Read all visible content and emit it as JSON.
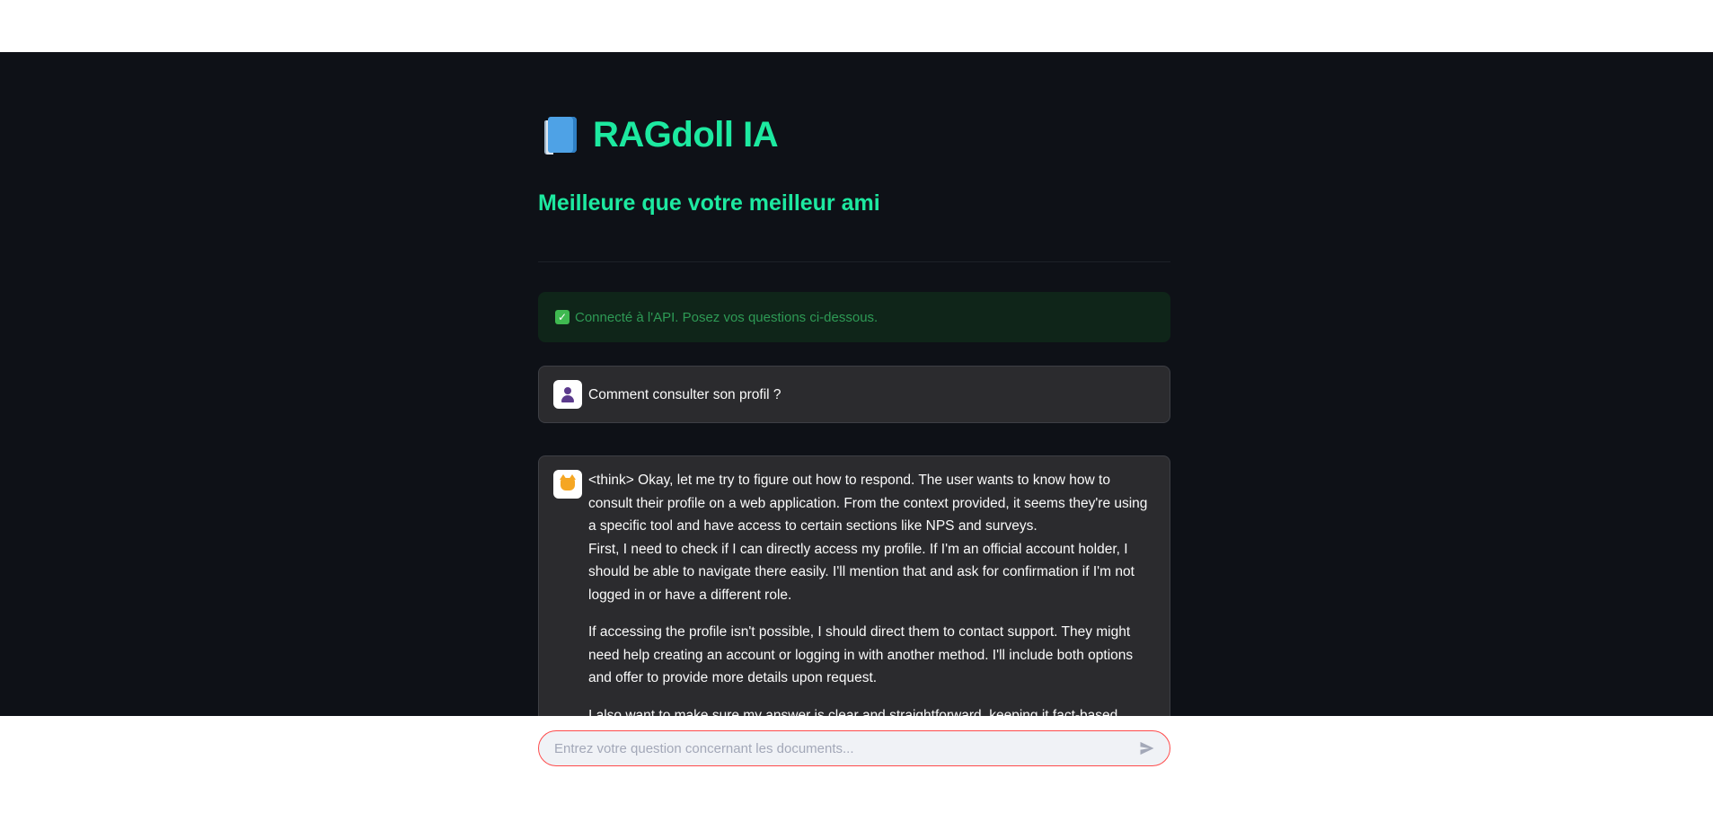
{
  "header": {
    "title": "RAGdoll IA",
    "title_icon": "book-icon",
    "subtitle": "Meilleure que votre meilleur ami"
  },
  "status": {
    "icon": "check-icon",
    "text": "Connecté à l'API. Posez vos questions ci-dessous."
  },
  "messages": [
    {
      "role": "user",
      "avatar": "user-icon",
      "text": "Comment consulter son profil ?"
    },
    {
      "role": "assistant",
      "avatar": "cat-icon",
      "paragraphs": [
        "<think> Okay, let me try to figure out how to respond. The user wants to know how to consult their profile on a web application. From the context provided, it seems they're using a specific tool and have access to certain sections like NPS and surveys.",
        "First, I need to check if I can directly access my profile. If I'm an official account holder, I should be able to navigate there easily. I'll mention that and ask for confirmation if I'm not logged in or have a different role.",
        "If accessing the profile isn't possible, I should direct them to contact support. They might need help creating an account or logging in with another method. I'll include both options and offer to provide more details upon request.",
        "I also want to make sure my answer is clear and straightforward, keeping it fact-based without"
      ]
    }
  ],
  "chat_input": {
    "placeholder": "Entrez votre question concernant les documents...",
    "value": "",
    "send_icon": "send-icon"
  },
  "colors": {
    "accent": "#1de9a0",
    "background": "#0e1117",
    "message_bg": "#2b2b2e",
    "status_bg": "#0f2519",
    "input_border": "#ff4b4b"
  }
}
